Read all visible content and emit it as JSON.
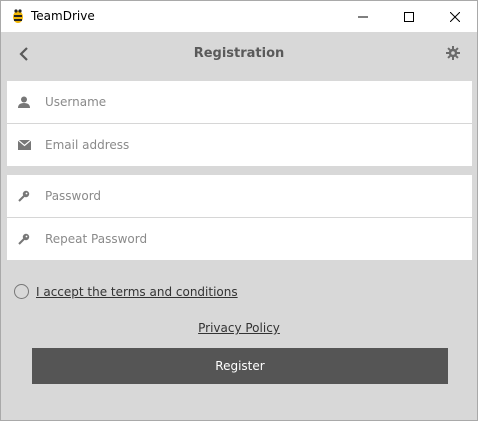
{
  "window": {
    "title": "TeamDrive",
    "controls": {
      "minimize": "minimize",
      "maximize": "maximize",
      "close": "close"
    }
  },
  "header": {
    "title": "Registration",
    "back_icon": "chevron-left-icon",
    "settings_icon": "gear-icon"
  },
  "form": {
    "username": {
      "value": "",
      "placeholder": "Username",
      "icon": "user-icon"
    },
    "email": {
      "value": "",
      "placeholder": "Email address",
      "icon": "envelope-icon"
    },
    "password": {
      "value": "",
      "placeholder": "Password",
      "icon": "key-icon"
    },
    "repeat_password": {
      "value": "",
      "placeholder": "Repeat Password",
      "icon": "key-icon"
    }
  },
  "terms": {
    "label": "I accept the terms and conditions",
    "checked": false
  },
  "privacy_link": "Privacy Policy",
  "register_button": "Register",
  "colors": {
    "background": "#d8d8d8",
    "button": "#555555",
    "field": "#ffffff",
    "title_text": "#5a5a5a"
  }
}
